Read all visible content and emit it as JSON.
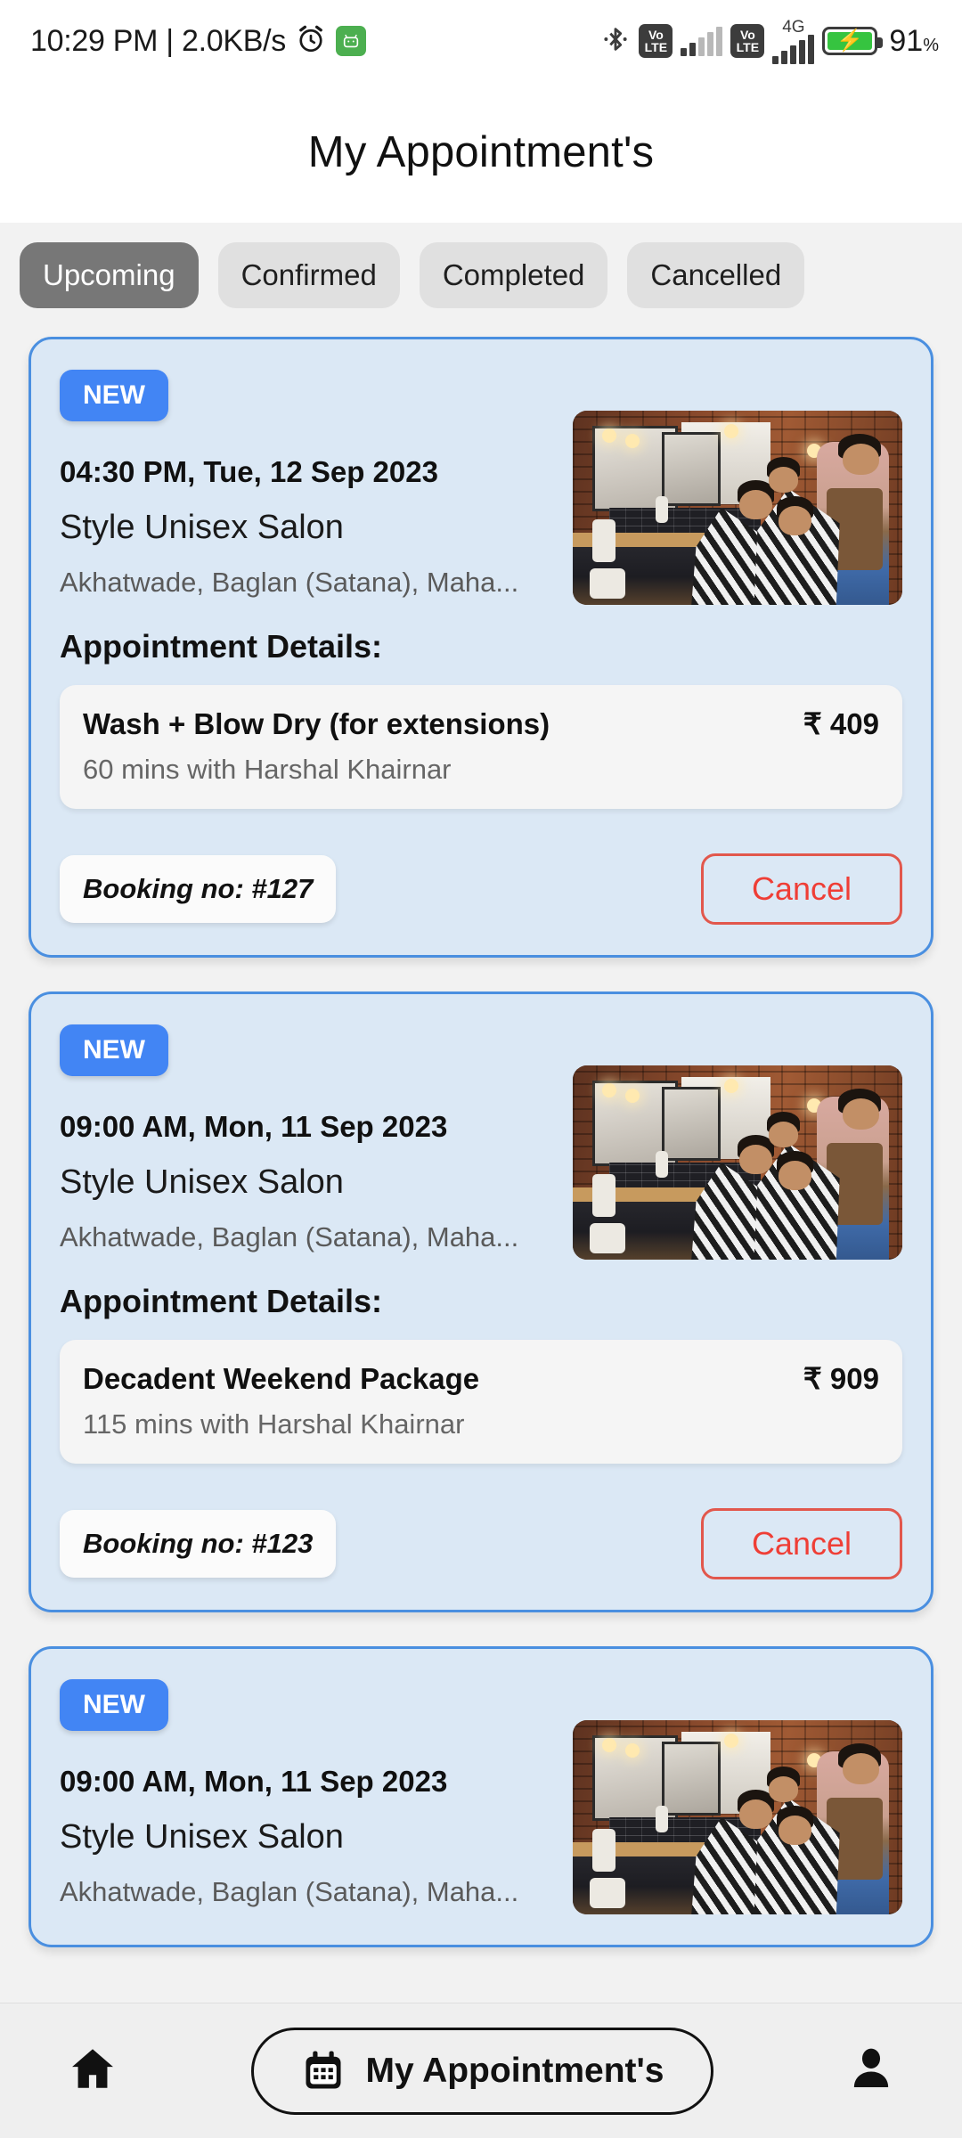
{
  "status_bar": {
    "clock": "10:29 PM | 2.0KB/s",
    "alarm_icon": "alarm-clock-icon",
    "app_icon": "android-app-icon",
    "bluetooth_icon": "bluetooth-icon",
    "sim1_volte": {
      "line1": "Vo",
      "line2": "LTE"
    },
    "sim2_volte": {
      "line1": "Vo",
      "line2": "LTE"
    },
    "network_type": "4G",
    "battery_percent": "91",
    "battery_percent_symbol": "%",
    "battery_charging": true
  },
  "header": {
    "title": "My Appointment's"
  },
  "tabs": [
    {
      "label": "Upcoming",
      "active": true
    },
    {
      "label": "Confirmed",
      "active": false
    },
    {
      "label": "Completed",
      "active": false
    },
    {
      "label": "Cancelled",
      "active": false
    }
  ],
  "details_label": "Appointment Details:",
  "cancel_label": "Cancel",
  "badge_label": "NEW",
  "appointments": [
    {
      "badge": "NEW",
      "datetime": "04:30 PM, Tue, 12 Sep 2023",
      "salon": "Style Unisex Salon",
      "address": "Akhatwade, Baglan (Satana), Maha...",
      "details_label": "Appointment Details:",
      "service_name": "Wash + Blow Dry (for extensions)",
      "service_price": "₹ 409",
      "service_sub": "60 mins with Harshal Khairnar",
      "booking": "Booking no: #127",
      "cancel": "Cancel",
      "photo_alt": "salon-photo"
    },
    {
      "badge": "NEW",
      "datetime": "09:00 AM, Mon, 11 Sep 2023",
      "salon": "Style Unisex Salon",
      "address": "Akhatwade, Baglan (Satana), Maha...",
      "details_label": "Appointment Details:",
      "service_name": "Decadent Weekend Package",
      "service_price": "₹ 909",
      "service_sub": "115 mins with Harshal Khairnar",
      "booking": "Booking no: #123",
      "cancel": "Cancel",
      "photo_alt": "salon-photo"
    },
    {
      "badge": "NEW",
      "datetime": "09:00 AM, Mon, 11 Sep 2023",
      "salon": "Style Unisex Salon",
      "address": "Akhatwade, Baglan (Satana), Maha...",
      "photo_alt": "salon-photo"
    }
  ],
  "bottom_nav": {
    "home_icon": "home-icon",
    "calendar_icon": "calendar-icon",
    "appointments_label": "My Appointment's",
    "profile_icon": "person-icon"
  },
  "colors": {
    "card_bg": "#dbe8f5",
    "card_border": "#4a8fe0",
    "badge_blue": "#4285f4",
    "cancel_red": "#ef3e36",
    "tab_active_bg": "#777777",
    "tab_bg": "#e0e0e0",
    "page_bg": "#f2f2f2",
    "battery_green": "#36c440"
  }
}
